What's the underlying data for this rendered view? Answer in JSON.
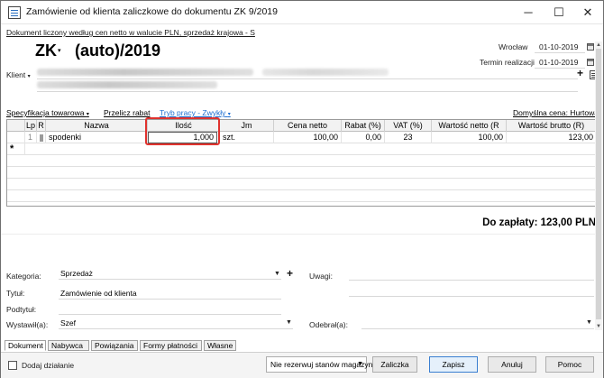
{
  "window": {
    "title": "Zamówienie od klienta zaliczkowe do dokumentu ZK 9/2019",
    "minimize": "─",
    "maximize": "☐",
    "close": "✕"
  },
  "subheader": "Dokument liczony według cen netto w walucie PLN, sprzedaż krajowa - S",
  "document": {
    "prefix": "ZK",
    "prefix_caret": "▾",
    "number": "(auto)/2019",
    "place_label": "Wrocław",
    "place_date": "01-10-2019",
    "realization_label": "Termin realizacji",
    "realization_date": "01-10-2019"
  },
  "client": {
    "label": "Klient",
    "caret": "▾"
  },
  "toolbar": {
    "spec": "Specyfikacja towarowa",
    "spec_caret": "▾",
    "recalc": "Przelicz rabat",
    "mode": "Tryb pracy - Zwykły",
    "mode_caret": "▾",
    "price": "Domyślna cena: Hurtowa"
  },
  "table": {
    "columns": [
      "Lp",
      "R",
      "Nazwa",
      "Ilość",
      "Jm",
      "Cena netto",
      "Rabat (%)",
      "VAT (%)",
      "Wartość netto (R",
      "Wartość brutto (R)"
    ],
    "rows": [
      {
        "lp": "1",
        "r": "",
        "nazwa": "spodenki",
        "ilosc": "1,000",
        "jm": "szt.",
        "cena": "100,00",
        "rabat": "0,00",
        "vat": "23",
        "netto": "100,00",
        "brutto": "123,00"
      }
    ],
    "new_row_marker": "*"
  },
  "total": "Do zapłaty: 123,00 PLN",
  "form": {
    "category_label": "Kategoria:",
    "category_value": "Sprzedaż",
    "title_label": "Tytuł:",
    "title_value": "Zamówienie od klienta",
    "subtitle_label": "Podtytuł:",
    "subtitle_value": "",
    "issued_label": "Wystawił(a):",
    "issued_value": "Szef",
    "notes_label": "Uwagi:",
    "received_label": "Odebrał(a):",
    "received_value": ""
  },
  "tabs": [
    "Dokument",
    "Nabywca",
    "Powiązania",
    "Formy płatności",
    "Własne"
  ],
  "bottom": {
    "add_action": "Dodaj działanie",
    "reserve": "Nie rezerwuj stanów magazynowych",
    "advance": "Zaliczka",
    "save": "Zapisz",
    "cancel": "Anuluj",
    "help": "Pomoc"
  }
}
